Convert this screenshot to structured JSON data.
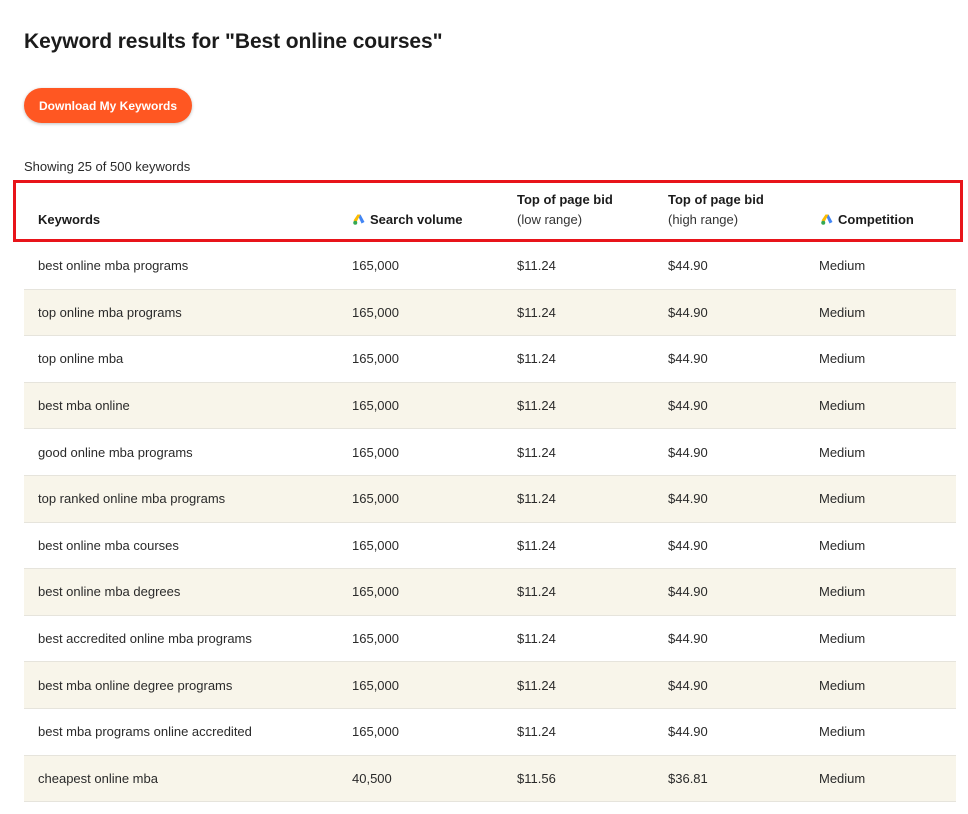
{
  "page": {
    "title": "Keyword results for \"Best online courses\"",
    "download_label": "Download My Keywords",
    "showing_text": "Showing 25 of 500 keywords"
  },
  "colors": {
    "accent": "#ff5722",
    "row_alt": "#f8f5ea",
    "highlight": "#e8141a"
  },
  "table": {
    "headers": {
      "keywords": "Keywords",
      "search_volume": "Search volume",
      "low_bid_title": "Top of page bid",
      "low_bid_sub": "(low range)",
      "high_bid_title": "Top of page bid",
      "high_bid_sub": "(high range)",
      "competition": "Competition",
      "icon": "google-ads-icon"
    },
    "rows": [
      {
        "keyword": "best online mba programs",
        "volume": "165,000",
        "low": "$11.24",
        "high": "$44.90",
        "competition": "Medium"
      },
      {
        "keyword": "top online mba programs",
        "volume": "165,000",
        "low": "$11.24",
        "high": "$44.90",
        "competition": "Medium"
      },
      {
        "keyword": "top online mba",
        "volume": "165,000",
        "low": "$11.24",
        "high": "$44.90",
        "competition": "Medium"
      },
      {
        "keyword": "best mba online",
        "volume": "165,000",
        "low": "$11.24",
        "high": "$44.90",
        "competition": "Medium"
      },
      {
        "keyword": "good online mba programs",
        "volume": "165,000",
        "low": "$11.24",
        "high": "$44.90",
        "competition": "Medium"
      },
      {
        "keyword": "top ranked online mba programs",
        "volume": "165,000",
        "low": "$11.24",
        "high": "$44.90",
        "competition": "Medium"
      },
      {
        "keyword": "best online mba courses",
        "volume": "165,000",
        "low": "$11.24",
        "high": "$44.90",
        "competition": "Medium"
      },
      {
        "keyword": "best online mba degrees",
        "volume": "165,000",
        "low": "$11.24",
        "high": "$44.90",
        "competition": "Medium"
      },
      {
        "keyword": "best accredited online mba programs",
        "volume": "165,000",
        "low": "$11.24",
        "high": "$44.90",
        "competition": "Medium"
      },
      {
        "keyword": "best mba online degree programs",
        "volume": "165,000",
        "low": "$11.24",
        "high": "$44.90",
        "competition": "Medium"
      },
      {
        "keyword": "best mba programs online accredited",
        "volume": "165,000",
        "low": "$11.24",
        "high": "$44.90",
        "competition": "Medium"
      },
      {
        "keyword": "cheapest online mba",
        "volume": "40,500",
        "low": "$11.56",
        "high": "$36.81",
        "competition": "Medium"
      }
    ]
  }
}
